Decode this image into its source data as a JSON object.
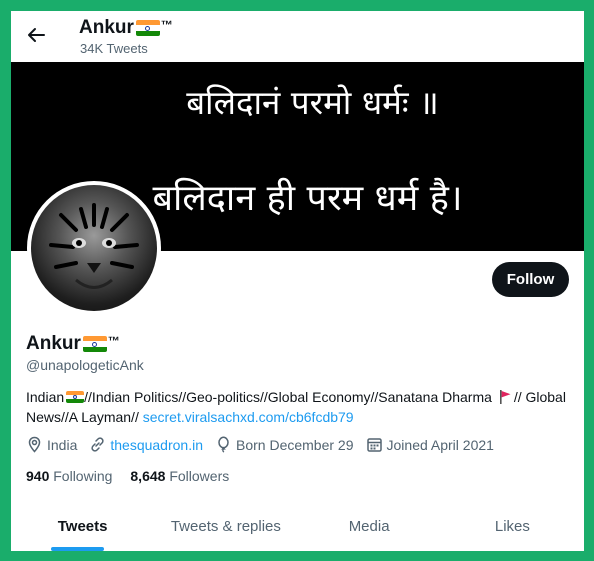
{
  "header": {
    "name": "Ankur",
    "trademark": "™",
    "tweet_count": "34K Tweets"
  },
  "banner": {
    "line1": "बलिदानं परमो धर्मः ॥",
    "line2": "बलिदान ही परम धर्म है।"
  },
  "profile": {
    "name": "Ankur",
    "trademark": "™",
    "handle": "@unapologeticAnk",
    "follow_label": "Follow",
    "bio": {
      "part1": "Indian",
      "part2": "//Indian Politics//Geo-politics//Global Economy//Sanatana Dharma ",
      "part3": "// Global News//A Layman// ",
      "link": "secret.viralsachxd.com/cb6fcdb79"
    },
    "location": "India",
    "website": "thesquadron.in",
    "born": "Born December 29",
    "joined": "Joined April 2021",
    "following_count": "940",
    "following_label": "Following",
    "followers_count": "8,648",
    "followers_label": "Followers"
  },
  "tabs": [
    {
      "label": "Tweets"
    },
    {
      "label": "Tweets & replies"
    },
    {
      "label": "Media"
    },
    {
      "label": "Likes"
    }
  ],
  "colors": {
    "page_border": "#1aad6b",
    "accent": "#1d9bf0",
    "text": "#0f1419",
    "muted": "#536471",
    "flag_saffron": "#ff9933",
    "flag_white": "#ffffff",
    "flag_green": "#138808"
  },
  "icons": {
    "back": "arrow-left-icon",
    "location": "map-pin-icon",
    "website": "link-icon",
    "born": "balloon-icon",
    "joined": "calendar-icon",
    "bio_flag": "red-flag-icon",
    "country_flag": "india-flag-icon"
  }
}
